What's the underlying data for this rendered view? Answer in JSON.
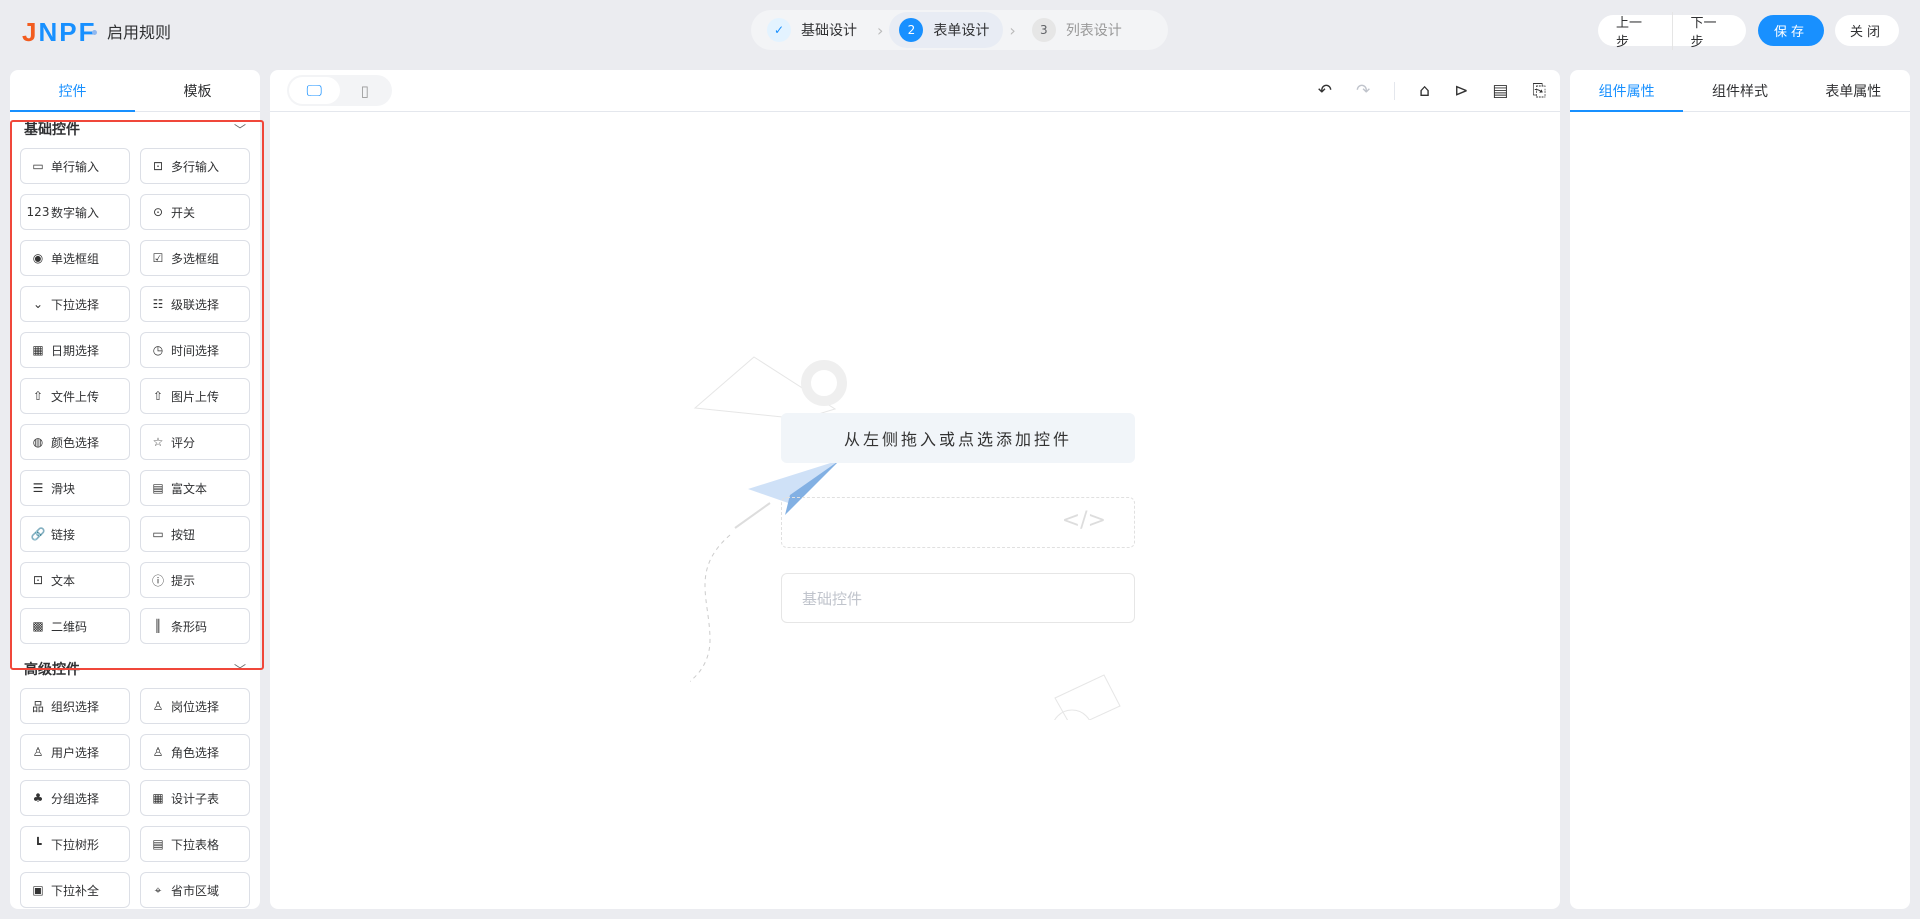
{
  "header": {
    "logo": "JNPF",
    "title": "启用规则",
    "steps": [
      {
        "num": "✓",
        "label": "基础设计",
        "state": "done"
      },
      {
        "num": "2",
        "label": "表单设计",
        "state": "active"
      },
      {
        "num": "3",
        "label": "列表设计",
        "state": "todo"
      }
    ],
    "prev": "上一步",
    "next": "下一步",
    "save": "保存",
    "close": "关闭"
  },
  "left": {
    "tabs": [
      "控件",
      "模板"
    ],
    "basic": {
      "title": "基础控件",
      "items": [
        {
          "label": "单行输入",
          "icon": "input-icon",
          "g": "▭"
        },
        {
          "label": "多行输入",
          "icon": "textarea-icon",
          "g": "⊡"
        },
        {
          "label": "数字输入",
          "icon": "number-icon",
          "g": "123"
        },
        {
          "label": "开关",
          "icon": "switch-icon",
          "g": "⊙"
        },
        {
          "label": "单选框组",
          "icon": "radio-icon",
          "g": "◉"
        },
        {
          "label": "多选框组",
          "icon": "checkbox-icon",
          "g": "☑"
        },
        {
          "label": "下拉选择",
          "icon": "select-icon",
          "g": "⌄"
        },
        {
          "label": "级联选择",
          "icon": "cascader-icon",
          "g": "☷"
        },
        {
          "label": "日期选择",
          "icon": "calendar-icon",
          "g": "▦"
        },
        {
          "label": "时间选择",
          "icon": "clock-icon",
          "g": "◷"
        },
        {
          "label": "文件上传",
          "icon": "upload-icon",
          "g": "⇧"
        },
        {
          "label": "图片上传",
          "icon": "image-upload-icon",
          "g": "⇧"
        },
        {
          "label": "颜色选择",
          "icon": "palette-icon",
          "g": "◍"
        },
        {
          "label": "评分",
          "icon": "star-icon",
          "g": "☆"
        },
        {
          "label": "滑块",
          "icon": "slider-icon",
          "g": "☰"
        },
        {
          "label": "富文本",
          "icon": "rich-text-icon",
          "g": "▤"
        },
        {
          "label": "链接",
          "icon": "link-icon",
          "g": "🔗"
        },
        {
          "label": "按钮",
          "icon": "button-icon",
          "g": "▭"
        },
        {
          "label": "文本",
          "icon": "text-icon",
          "g": "⊡"
        },
        {
          "label": "提示",
          "icon": "alert-icon",
          "g": "ⓘ"
        },
        {
          "label": "二维码",
          "icon": "qrcode-icon",
          "g": "▩"
        },
        {
          "label": "条形码",
          "icon": "barcode-icon",
          "g": "║"
        }
      ]
    },
    "advanced": {
      "title": "高级控件",
      "items": [
        {
          "label": "组织选择",
          "icon": "org-icon",
          "g": "品"
        },
        {
          "label": "岗位选择",
          "icon": "position-icon",
          "g": "♙"
        },
        {
          "label": "用户选择",
          "icon": "user-icon",
          "g": "♙"
        },
        {
          "label": "角色选择",
          "icon": "role-icon",
          "g": "♙"
        },
        {
          "label": "分组选择",
          "icon": "group-icon",
          "g": "♣"
        },
        {
          "label": "设计子表",
          "icon": "table-icon",
          "g": "▦"
        },
        {
          "label": "下拉树形",
          "icon": "tree-icon",
          "g": "┗"
        },
        {
          "label": "下拉表格",
          "icon": "table-select-icon",
          "g": "▤"
        },
        {
          "label": "下拉补全",
          "icon": "autocomplete-icon",
          "g": "▣"
        },
        {
          "label": "省市区域",
          "icon": "location-icon",
          "g": "⌖"
        }
      ]
    }
  },
  "canvas": {
    "hint": "从左侧拖入或点选添加控件",
    "placeholder": "基础控件"
  },
  "right": {
    "tabs": [
      "组件属性",
      "组件样式",
      "表单属性"
    ]
  },
  "colors": {
    "accent": "#1890ff",
    "highlight": "#f0473a"
  }
}
